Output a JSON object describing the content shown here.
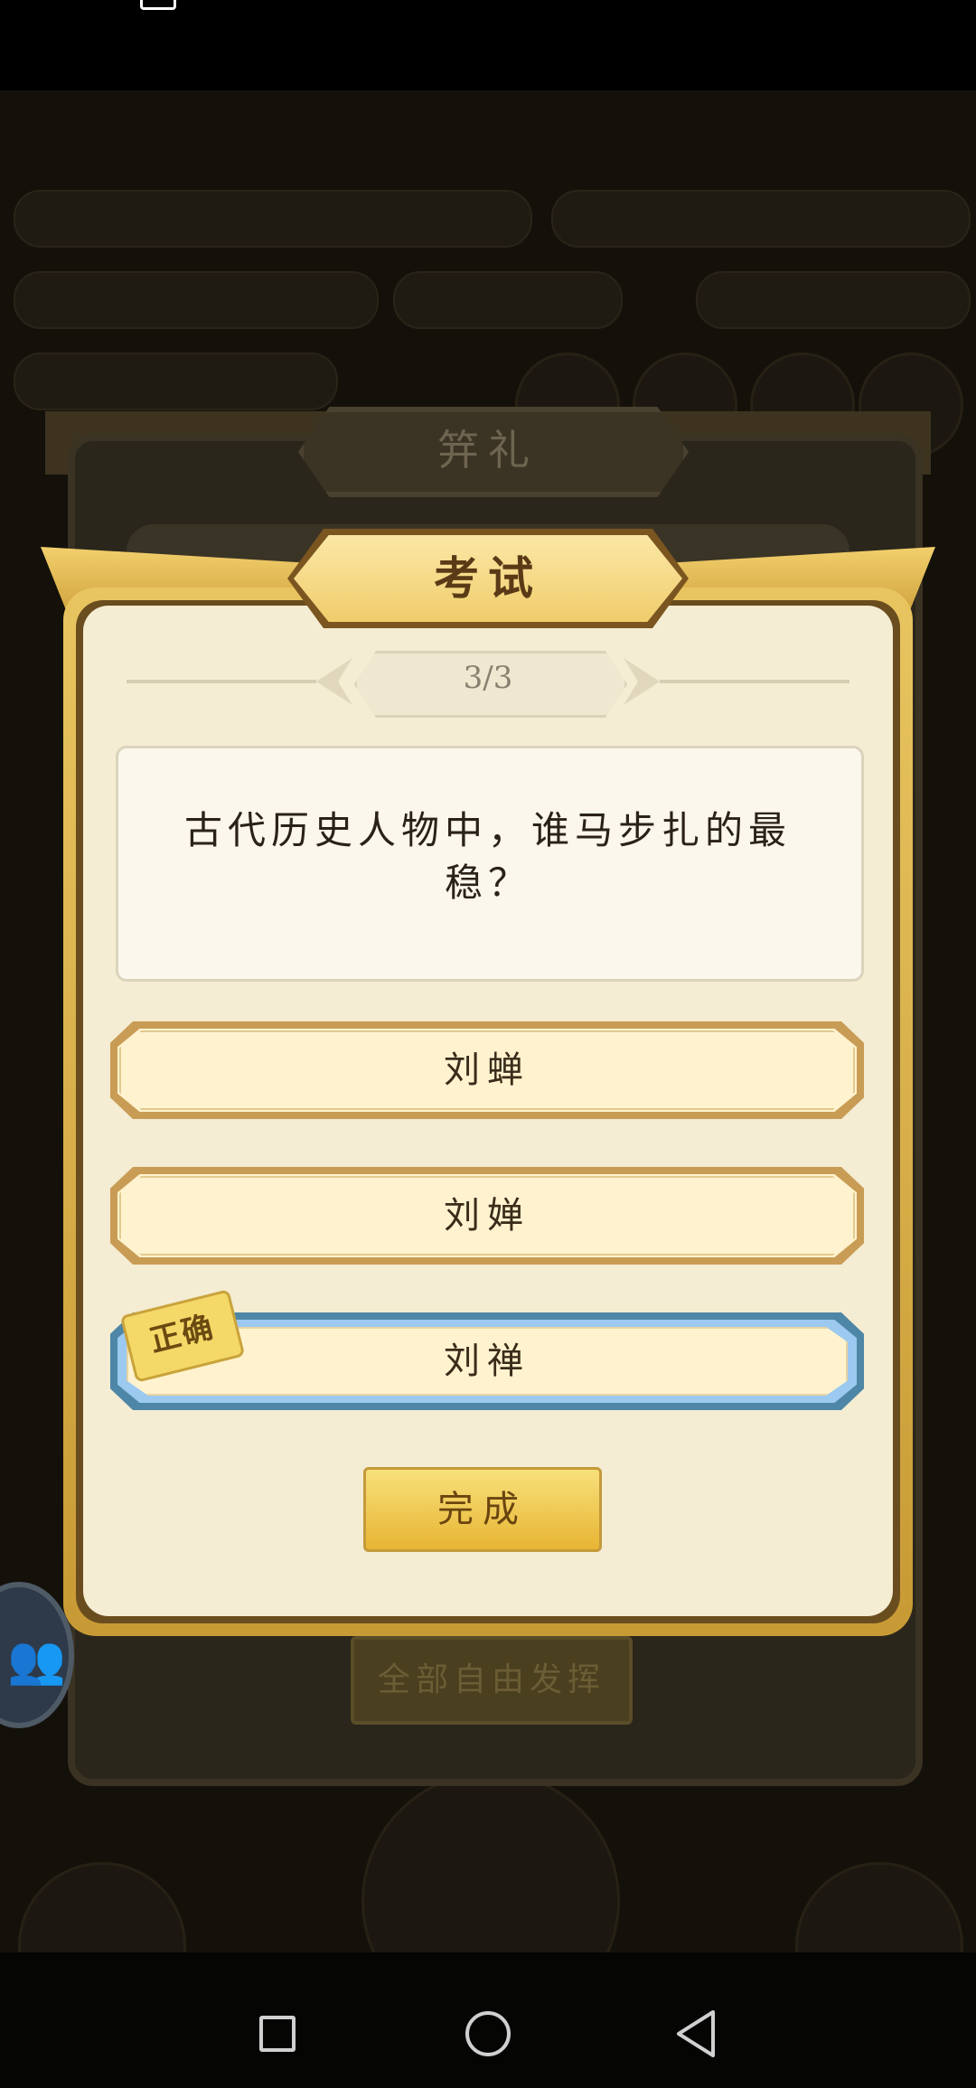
{
  "background_panel": {
    "title": "笄礼",
    "button_label": "全部自由发挥"
  },
  "dialog": {
    "title": "考试",
    "progress": "3/3",
    "question": "古代历史人物中，谁马步扎的最稳？",
    "options": [
      {
        "label": "刘蝉",
        "correct": false
      },
      {
        "label": "刘婵",
        "correct": false
      },
      {
        "label": "刘禅",
        "correct": true
      }
    ],
    "correct_tag": "正确",
    "done_label": "完成"
  },
  "colors": {
    "dialog_gold": "#e8c560",
    "paper": "#f4ecd3",
    "correct_highlight": "#9cc9ef"
  },
  "icons": {
    "nav_recent": "square-icon",
    "nav_home": "circle-icon",
    "nav_back": "back-triangle-icon",
    "avatar": "people-icon"
  }
}
